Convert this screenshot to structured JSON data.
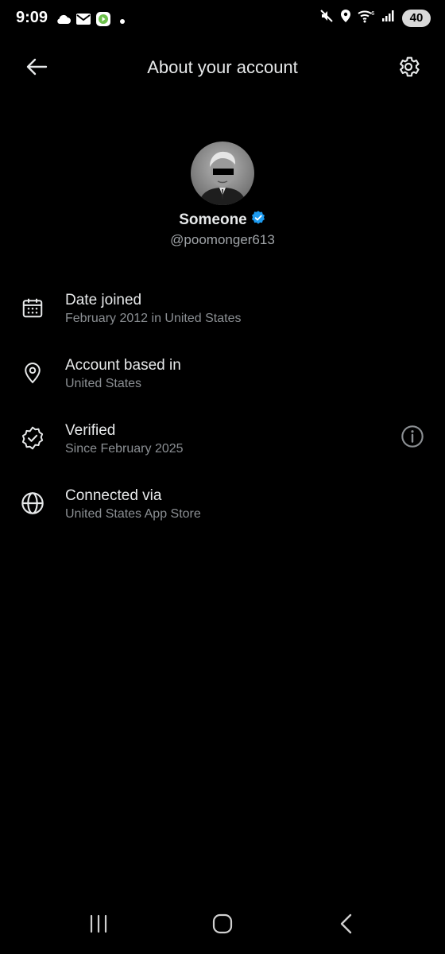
{
  "status_bar": {
    "time": "9:09",
    "battery": "40",
    "left_icons": [
      "cloud-icon",
      "mail-icon",
      "app-notification-icon",
      "dot-icon"
    ],
    "right_icons": [
      "mute-icon",
      "location-icon",
      "wifi-6-icon",
      "signal-icon",
      "battery-icon"
    ]
  },
  "header": {
    "title": "About your account",
    "back_icon": "arrow-left-icon",
    "settings_icon": "gear-icon"
  },
  "profile": {
    "display_name": "Someone",
    "handle": "@poomonger613",
    "verified_badge_color": "#1d9bf0"
  },
  "info_items": [
    {
      "icon": "calendar-icon",
      "label": "Date joined",
      "value": "February 2012 in United States"
    },
    {
      "icon": "location-pin-icon",
      "label": "Account based in",
      "value": "United States"
    },
    {
      "icon": "verified-check-icon",
      "label": "Verified",
      "value": "Since February 2025",
      "trailing_icon": "info-icon"
    },
    {
      "icon": "globe-icon",
      "label": "Connected via",
      "value": "United States App Store"
    }
  ],
  "nav_bar": {
    "icons": [
      "recent-apps-icon",
      "home-icon",
      "back-icon"
    ]
  },
  "colors": {
    "background": "#000000",
    "primary_text": "#e7e9ea",
    "secondary_text": "#8b8f93",
    "accent": "#1d9bf0"
  }
}
